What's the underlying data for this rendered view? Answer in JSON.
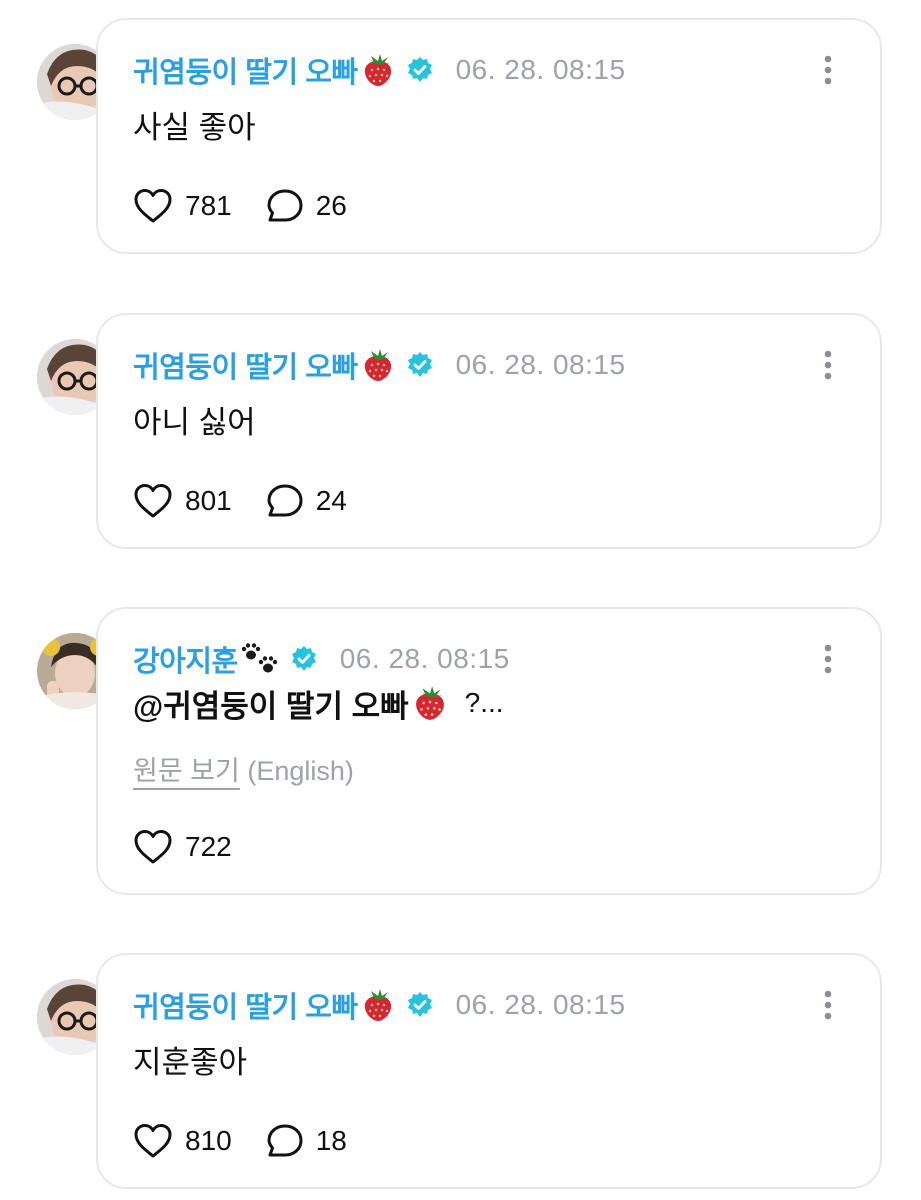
{
  "posts": [
    {
      "author": "귀염둥이 딸기 오빠",
      "author_emoji": "strawberry-icon",
      "verified": true,
      "timestamp": "06. 28. 08:15",
      "text": "사실 좋아",
      "likes": "781",
      "comments": "26"
    },
    {
      "author": "귀염둥이 딸기 오빠",
      "author_emoji": "strawberry-icon",
      "verified": true,
      "timestamp": "06. 28. 08:15",
      "text": "아니 싫어",
      "likes": "801",
      "comments": "24"
    },
    {
      "author": "강아지훈",
      "author_emoji": "paw-prints-icon",
      "verified": true,
      "timestamp": "06. 28. 08:15",
      "mention": "@귀염둥이 딸기 오빠",
      "mention_emoji": "strawberry-icon",
      "text": "?...",
      "translate_label": "원문 보기",
      "translate_lang": "(English)",
      "likes": "722"
    },
    {
      "author": "귀염둥이 딸기 오빠",
      "author_emoji": "strawberry-icon",
      "verified": true,
      "timestamp": "06. 28. 08:15",
      "text": "지훈좋아",
      "likes": "810",
      "comments": "18"
    }
  ],
  "colors": {
    "name": "#2aa0e0",
    "verified_badge": "#27c3dc",
    "timestamp": "#9ea1a8",
    "card_border": "#e6e8ee",
    "strawberry": "#d62533"
  },
  "icons": [
    "heart-icon",
    "comment-icon",
    "more-options-icon",
    "verified-badge-icon",
    "strawberry-icon",
    "paw-prints-icon"
  ]
}
